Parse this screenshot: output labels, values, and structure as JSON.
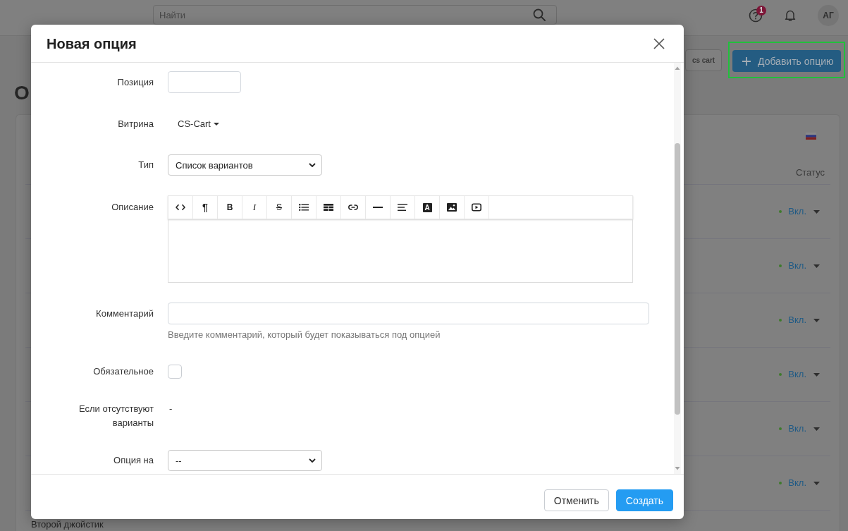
{
  "header": {
    "search": {
      "placeholder": "Найти"
    },
    "help_badge": "1",
    "avatar": "АГ"
  },
  "page": {
    "title": "О",
    "storefront_button": "cs cart",
    "add_button": {
      "label": "Добавить опцию",
      "highlighted": true
    },
    "table": {
      "columns": [
        "Статус"
      ],
      "rows": [
        {
          "status": "Вкл."
        },
        {
          "status": "Вкл."
        },
        {
          "status": "Вкл."
        },
        {
          "status": "Вкл."
        },
        {
          "status": "Вкл."
        },
        {
          "status": "Вкл."
        },
        {
          "name": "Второй джойстик"
        }
      ]
    }
  },
  "modal": {
    "title": "Новая опция",
    "fields": [
      {
        "kind": "short_input",
        "label": "Позиция"
      },
      {
        "kind": "dropdown_link",
        "label": "Витрина",
        "value": "CS-Cart"
      },
      {
        "kind": "select",
        "label": "Тип",
        "value": "Список вариантов"
      },
      {
        "kind": "editor",
        "label": "Описание",
        "toolbar": [
          {
            "kind": "code"
          },
          {
            "kind": "paragraph",
            "text": "¶"
          },
          {
            "kind": "bold",
            "text": "B"
          },
          {
            "kind": "italic",
            "text": "I"
          },
          {
            "kind": "strike",
            "text": "S"
          },
          {
            "kind": "list"
          },
          {
            "kind": "table"
          },
          {
            "kind": "link"
          },
          {
            "kind": "rule"
          },
          {
            "kind": "align"
          },
          {
            "kind": "color",
            "text": "A"
          },
          {
            "kind": "image"
          },
          {
            "kind": "video"
          }
        ]
      },
      {
        "kind": "wide_input",
        "label": "Комментарий",
        "help": "Введите комментарий, который будет показываться под опцией"
      },
      {
        "kind": "checkbox",
        "label": "Обязательное",
        "checked": false
      },
      {
        "kind": "text",
        "label": "Если отсутствуют варианты",
        "value": "-"
      },
      {
        "kind": "select",
        "label": "Опция на",
        "value": "--"
      }
    ],
    "buttons": [
      {
        "kind": "secondary",
        "label": "Отменить"
      },
      {
        "kind": "primary",
        "label": "Создать"
      }
    ]
  }
}
